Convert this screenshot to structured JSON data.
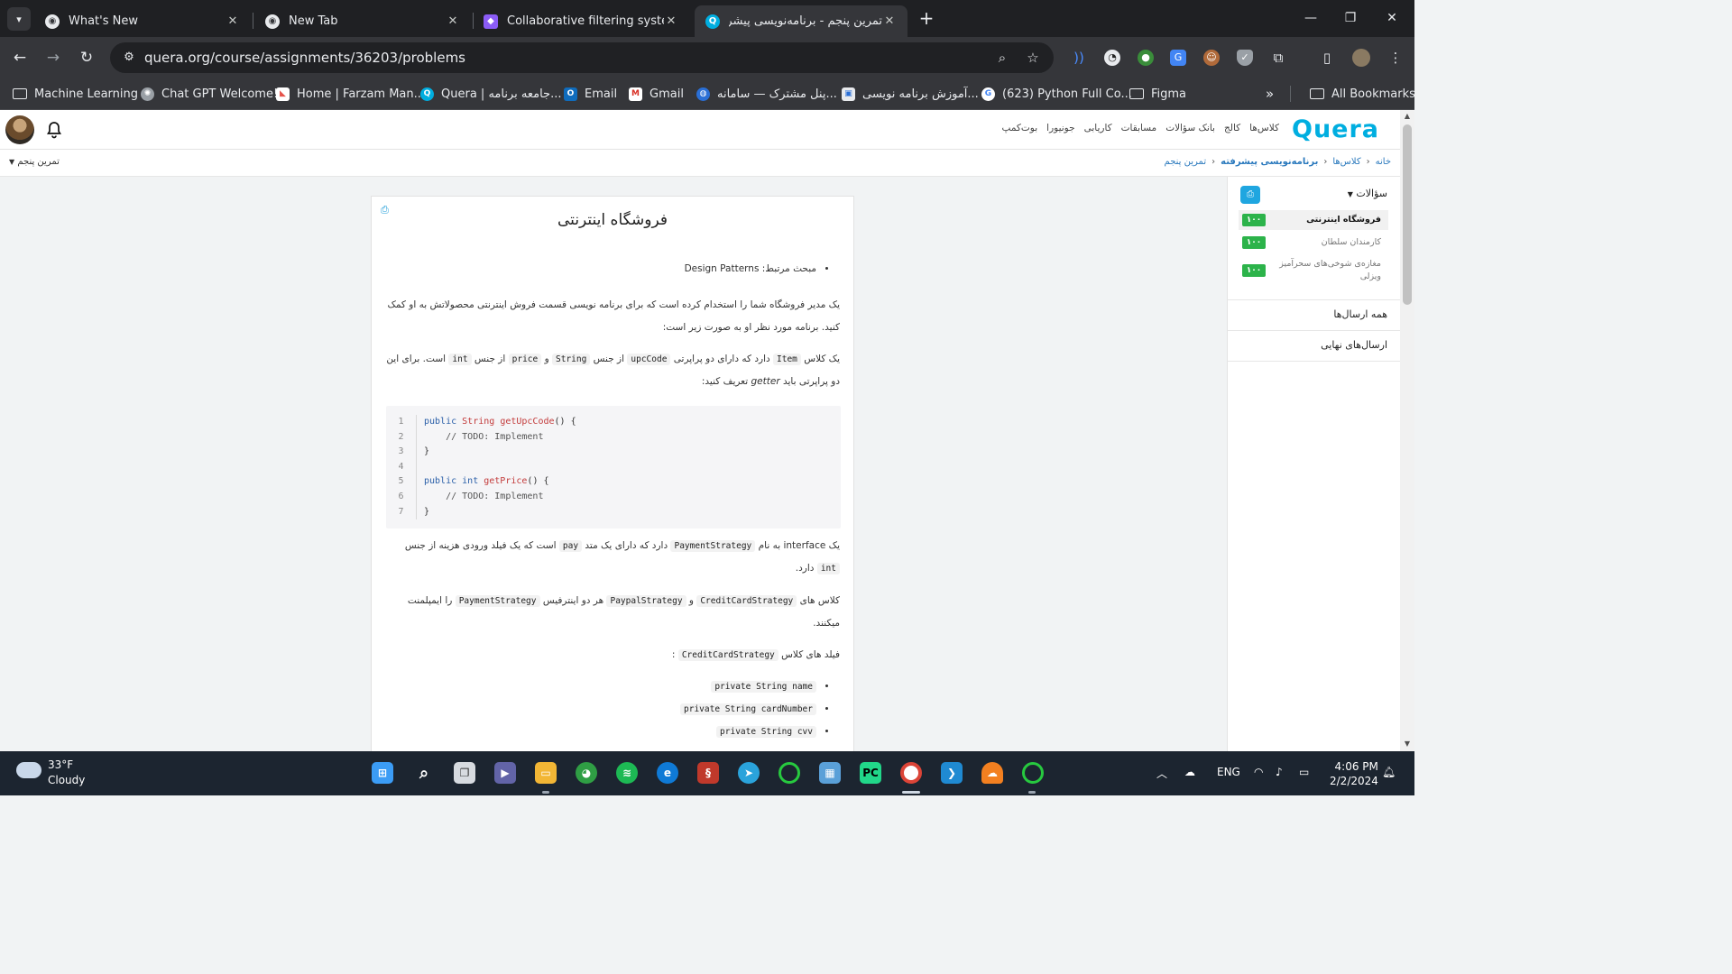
{
  "browser": {
    "tabs": [
      {
        "title": "What's New",
        "active": false
      },
      {
        "title": "New Tab",
        "active": false
      },
      {
        "title": "Collaborative filtering system | (",
        "active": false
      },
      {
        "title": "تمرین پنجم - برنامه‌نویسی پیشرفته",
        "active": true
      }
    ],
    "url": "quera.org/course/assignments/36203/problems",
    "bookmarks": [
      {
        "label": "Machine Learning",
        "icon": "folder-icon"
      },
      {
        "label": "Chat GPT Welcome!",
        "icon": "chatgpt-icon"
      },
      {
        "label": "Home | Farzam Man...",
        "icon": "clickup-icon"
      },
      {
        "label": "Quera | جامعه برنامه...",
        "icon": "quera-icon"
      },
      {
        "label": "Email",
        "icon": "outlook-icon"
      },
      {
        "label": "Gmail",
        "icon": "gmail-icon"
      },
      {
        "label": "پنل مشترک — سامانه...",
        "icon": "globe-icon"
      },
      {
        "label": "آموزش برنامه نویسی...",
        "icon": "image-icon"
      },
      {
        "label": "(623) Python Full Co...",
        "icon": "google-icon"
      },
      {
        "label": "Figma",
        "icon": "folder-icon"
      }
    ],
    "all_bookmarks": "All Bookmarks"
  },
  "quera": {
    "logo": "Quera",
    "nav": [
      "کلاس‌ها",
      "کالج",
      "بانک سؤالات",
      "مسابقات",
      "کاریابی",
      "جونیورا",
      "بوت‌کمپ"
    ],
    "breadcrumb": [
      "خانه",
      "کلاس‌ها",
      "برنامه‌نویسی پیشرفته",
      "تمرین پنجم"
    ],
    "assignment_selector": "تمرین پنجم"
  },
  "problem": {
    "title": "فروشگاه اینترنتی",
    "topic_label": "مبحث مرتبط:",
    "topic_value": "Design Patterns",
    "p1": "یک مدیر فروشگاه شما را استخدام کرده است که برای برنامه نویسی قسمت فروش اینترنتی محصولاتش به او کمک کنید. برنامه مورد نظر او به صورت زیر است:",
    "p2_a": "یک کلاس",
    "p2_item": "Item",
    "p2_b": "دارد که دارای دو پراپرتی",
    "p2_upc": "upcCode",
    "p2_c": "از جنس",
    "p2_string": "String",
    "p2_d": "و",
    "p2_price": "price",
    "p2_e": "از جنس",
    "p2_int": "int",
    "p2_f": "است. برای این دو پراپرتی باید",
    "p2_getter": "getter",
    "p2_g": "تعریف کنید:",
    "code_lines": [
      "1",
      "2",
      "3",
      "4",
      "5",
      "6",
      "7"
    ],
    "p3_a": "یک interface به نام",
    "p3_ps": "PaymentStrategy",
    "p3_b": "دارد که دارای یک متد",
    "p3_pay": "pay",
    "p3_c": "است که یک فیلد ورودی هزینه از جنس",
    "p3_int": "int",
    "p3_d": "دارد.",
    "p4_a": "کلاس های",
    "p4_cc": "CreditCardStrategy",
    "p4_b": "و",
    "p4_pp": "PaypalStrategy",
    "p4_c": "هر دو اینترفیس",
    "p4_ps": "PaymentStrategy",
    "p4_d": "را ایمپلمنت میکنند.",
    "p5_a": "فیلد های کلاس",
    "p5_cc": "CreditCardStrategy",
    "p5_b": ":",
    "fields": [
      "private String name",
      "private String cardNumber",
      "private String cvv"
    ]
  },
  "sidebar": {
    "header": "سؤالات",
    "problems": [
      {
        "name": "فروشگاه اینترنتی",
        "score": "۱۰۰",
        "active": true
      },
      {
        "name": "کارمندان سلطان",
        "score": "۱۰۰",
        "active": false
      },
      {
        "name": "مغازه‌ی شوخی‌های سحرآمیز ویزلی",
        "score": "۱۰۰",
        "active": false
      }
    ],
    "all_submissions": "همه ارسال‌ها",
    "final_submissions": "ارسال‌های نهایی"
  },
  "taskbar": {
    "temperature": "33°F",
    "condition": "Cloudy",
    "language": "ENG",
    "time": "4:06 PM",
    "date": "2/2/2024"
  },
  "colors": {
    "quera_blue": "#00aee0",
    "score_green": "#2cb34a",
    "link_blue": "#2a79bd"
  }
}
